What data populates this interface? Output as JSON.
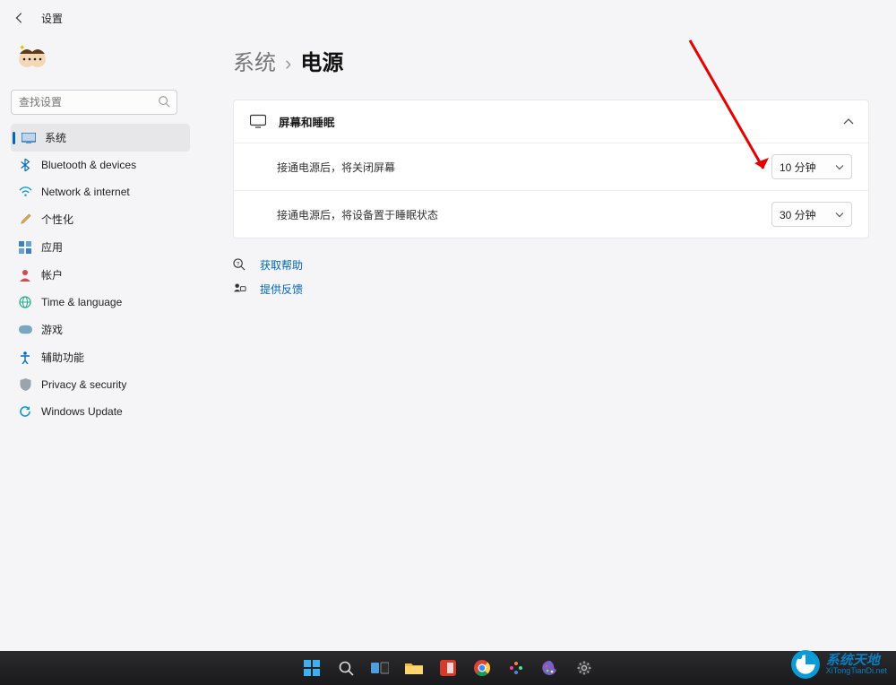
{
  "header": {
    "app_title": "设置"
  },
  "search": {
    "placeholder": "查找设置"
  },
  "sidebar": {
    "items": [
      {
        "label": "系统"
      },
      {
        "label": "Bluetooth & devices"
      },
      {
        "label": "Network & internet"
      },
      {
        "label": "个性化"
      },
      {
        "label": "应用"
      },
      {
        "label": "帐户"
      },
      {
        "label": "Time & language"
      },
      {
        "label": "游戏"
      },
      {
        "label": "辅助功能"
      },
      {
        "label": "Privacy & security"
      },
      {
        "label": "Windows Update"
      }
    ]
  },
  "breadcrumb": {
    "parent": "系统",
    "current": "电源"
  },
  "card": {
    "title": "屏幕和睡眠",
    "rows": [
      {
        "label": "接通电源后，将关闭屏幕",
        "value": "10 分钟"
      },
      {
        "label": "接通电源后，将设备置于睡眠状态",
        "value": "30 分钟"
      }
    ]
  },
  "help": {
    "get_help": "获取帮助",
    "feedback": "提供反馈"
  },
  "watermark": {
    "line1": "系统天地",
    "line2": "XiTongTianDi.net"
  },
  "colors": {
    "accent": "#0067c0"
  }
}
